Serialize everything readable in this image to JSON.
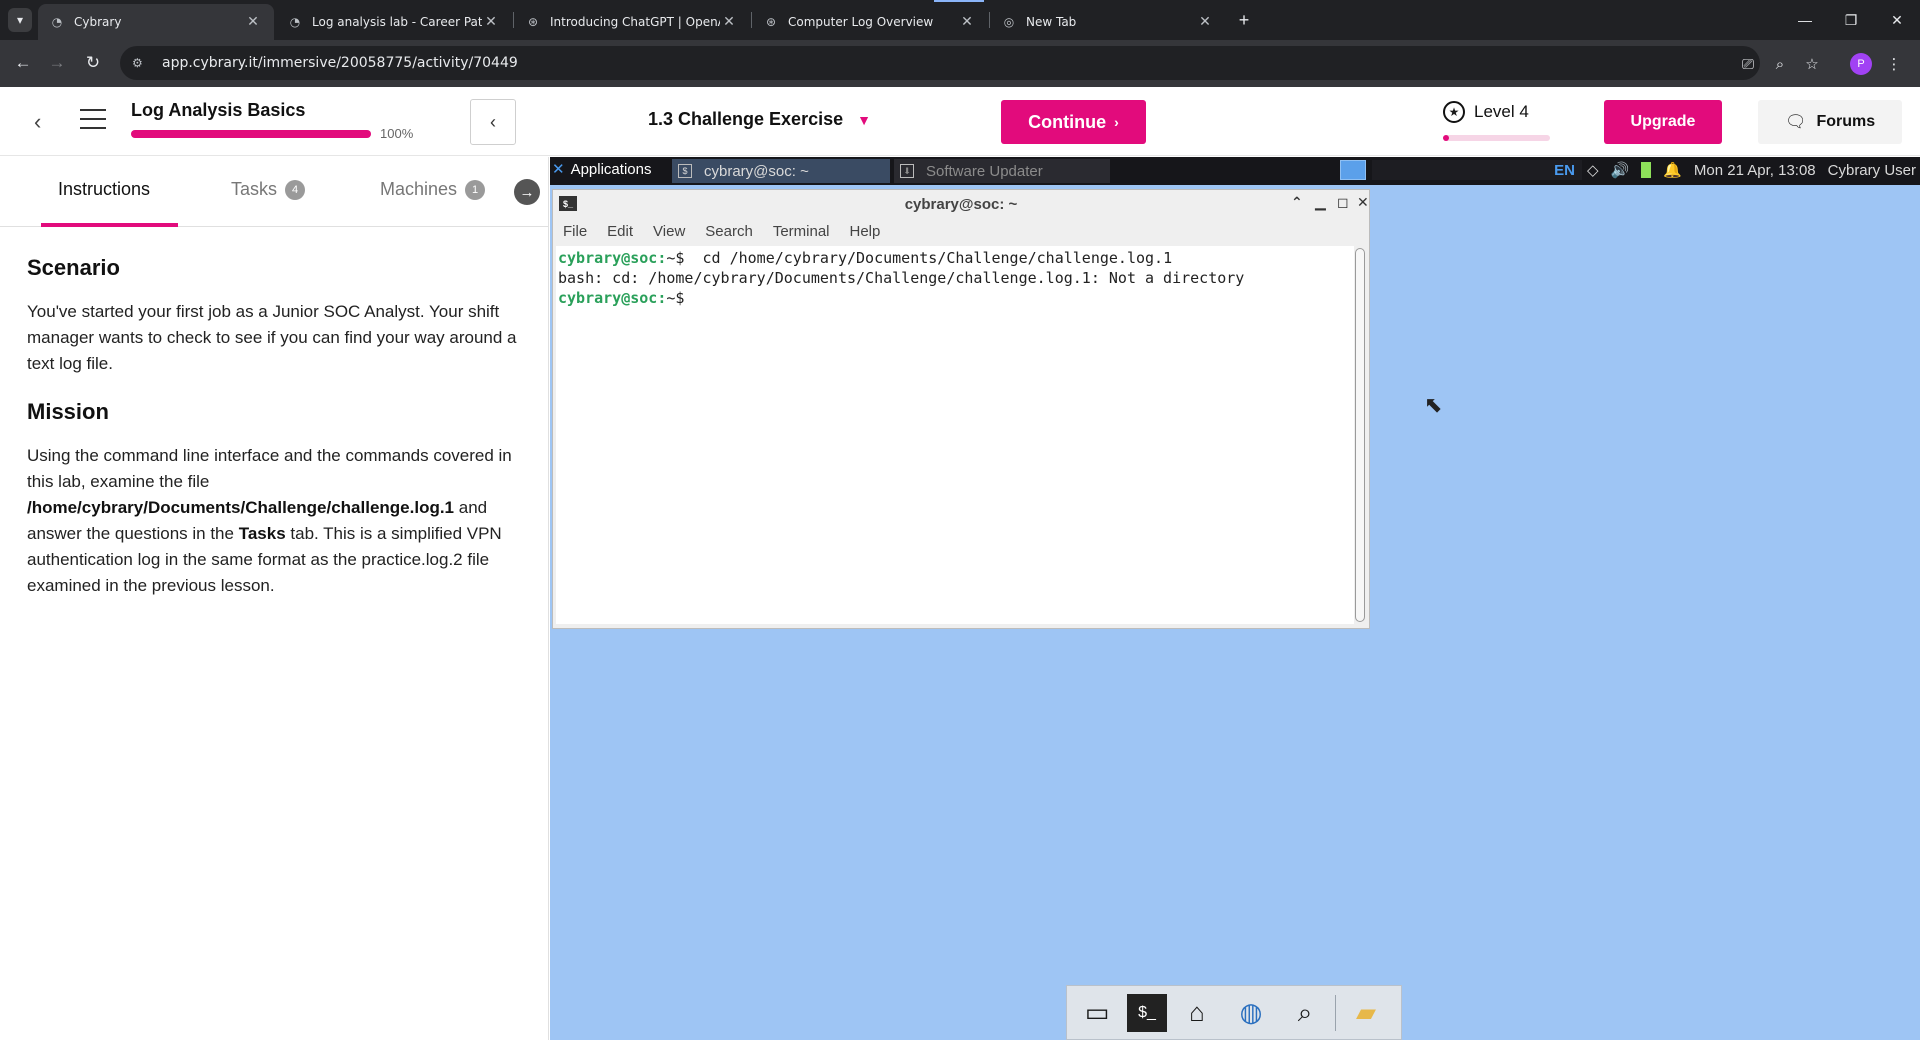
{
  "browser": {
    "tabs": [
      {
        "title": "Cybrary",
        "icon": "cybrary-icon",
        "active": true
      },
      {
        "title": "Log analysis lab - Career Paths",
        "icon": "cybrary-icon",
        "active": false
      },
      {
        "title": "Introducing ChatGPT | OpenAI",
        "icon": "openai-icon",
        "active": false
      },
      {
        "title": "Computer Log Overview",
        "icon": "openai-icon",
        "active": false
      },
      {
        "title": "New Tab",
        "icon": "chrome-icon",
        "active": false
      }
    ],
    "url": "app.cybrary.it/immersive/20058775/activity/70449",
    "profile_initial": "P"
  },
  "header": {
    "course_title": "Log Analysis Basics",
    "progress_percent": 100,
    "progress_label": "100%",
    "activity_title": "1.3 Challenge Exercise",
    "continue_label": "Continue",
    "level_label": "Level 4",
    "level_progress": 0.06,
    "upgrade_label": "Upgrade",
    "forums_label": "Forums",
    "accent_color": "#e20b7c"
  },
  "panel": {
    "tabs": [
      {
        "label": "Instructions",
        "badge": ""
      },
      {
        "label": "Tasks",
        "badge": "4"
      },
      {
        "label": "Machines",
        "badge": "1"
      }
    ],
    "scenario_heading": "Scenario",
    "scenario_text": "You've started your first job as a Junior SOC Analyst. Your shift manager wants to check to see if you can find your way around a text log file.",
    "mission_heading": "Mission",
    "mission_part1": "Using the command line interface and the commands covered in this lab, examine the file",
    "mission_path": "/home/cybrary/Documents/Challenge/challenge.log.1",
    "mission_part2": "and answer the questions in the",
    "mission_tasks_word": "Tasks",
    "mission_part3": "tab. This is a simplified VPN authentication log in the same format as the practice.log.2 file examined in the previous lesson."
  },
  "desktop": {
    "panel": {
      "applications_label": "Applications",
      "task1_label": "cybrary@soc: ~",
      "task2_label": "Software Updater",
      "lang": "EN",
      "datetime": "Mon 21 Apr, 13:08",
      "user": "Cybrary User"
    },
    "terminal": {
      "title": "cybrary@soc: ~",
      "menu": [
        "File",
        "Edit",
        "View",
        "Search",
        "Terminal",
        "Help"
      ],
      "prompt": "cybrary@soc:",
      "line1_cmd": "~$  cd /home/cybrary/Documents/Challenge/challenge.log.1",
      "line2": "bash: cd: /home/cybrary/Documents/Challenge/challenge.log.1: Not a directory",
      "line3_cmd": "~$ "
    },
    "background_color": "#9ec5f4"
  }
}
